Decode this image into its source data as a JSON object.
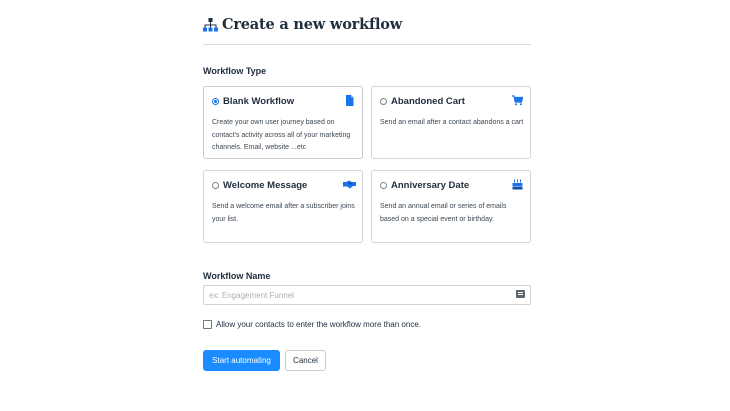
{
  "header": {
    "title": "Create a new workflow",
    "icon": "sitemap-icon"
  },
  "workflow_type": {
    "label": "Workflow Type",
    "selected": "blank",
    "cards": [
      {
        "id": "blank",
        "title": "Blank Workflow",
        "description": "Create your own user journey based on contact's activity across all of your marketing channels. Email, website ...etc",
        "icon": "document-icon",
        "selected": true
      },
      {
        "id": "abandoned",
        "title": "Abandoned Cart",
        "description": "Send an email after a contact abandons a cart",
        "icon": "shopping-cart-icon",
        "selected": false
      },
      {
        "id": "welcome",
        "title": "Welcome Message",
        "description": "Send a welcome email after a subscriber joins your list.",
        "icon": "handshake-icon",
        "selected": false
      },
      {
        "id": "anniversary",
        "title": "Anniversary Date",
        "description": "Send an annual email or series of emails based on a special event or birthday.",
        "icon": "birthday-cake-icon",
        "selected": false
      }
    ]
  },
  "workflow_name": {
    "label": "Workflow Name",
    "value": "",
    "placeholder": "ex: Engagement Funnel",
    "icon": "id-card-icon"
  },
  "allow_reentry": {
    "label": "Allow your contacts to enter the workflow more than once.",
    "checked": false
  },
  "actions": {
    "submit_label": "Start automating",
    "cancel_label": "Cancel"
  },
  "colors": {
    "primary": "#1a8cff",
    "text": "#1f2d3d",
    "icon_blue": "#1a73e8"
  }
}
